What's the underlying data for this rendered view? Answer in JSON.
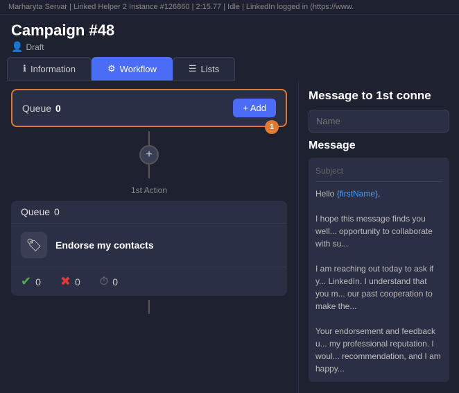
{
  "topbar": {
    "text": "Marharyta Servar | Linked Helper 2 Instance #126860 | 2:15.77 | Idle | LinkedIn logged in (https://www."
  },
  "header": {
    "campaign_title": "Campaign #48",
    "draft_label": "Draft"
  },
  "tabs": [
    {
      "id": "information",
      "label": "Information",
      "icon": "ℹ"
    },
    {
      "id": "workflow",
      "label": "Workflow",
      "icon": "⚙",
      "active": true
    },
    {
      "id": "lists",
      "label": "Lists",
      "icon": "☰"
    }
  ],
  "workflow": {
    "queue_label": "Queue",
    "queue_count": "0",
    "add_button_label": "+ Add",
    "badge": "1",
    "plus_icon": "+",
    "action_label": "1st Action",
    "action_queue_label": "Queue",
    "action_queue_count": "0",
    "action_name": "Endorse my contacts",
    "stats": {
      "check_count": "0",
      "x_count": "0",
      "clock_count": "0"
    }
  },
  "right_panel": {
    "title": "Message to 1st conne",
    "name_placeholder": "Name",
    "message_label": "Message",
    "subject_placeholder": "Subject",
    "message_body_1": "Hello {firstName},",
    "message_body_2": "I hope this message finds you well... opportunity to collaborate with su...",
    "message_body_3": "I am reaching out today to ask if y... LinkedIn. I understand that you m... our past cooperation to make the...",
    "message_body_4": "Your endorsement and feedback u... my professional reputation. I woul... recommendation, and I am happy..."
  }
}
